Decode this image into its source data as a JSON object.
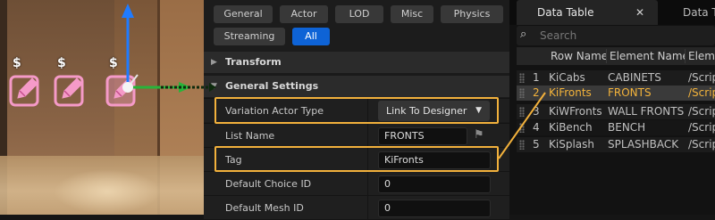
{
  "details": {
    "filter_tabs": [
      {
        "label": "General"
      },
      {
        "label": "Actor"
      },
      {
        "label": "LOD"
      },
      {
        "label": "Misc"
      },
      {
        "label": "Physics"
      },
      {
        "label": "Streaming"
      },
      {
        "label": "All",
        "active": true
      }
    ],
    "sections": {
      "transform": "Transform",
      "general_settings": "General Settings"
    },
    "properties": [
      {
        "label": "Variation Actor Type",
        "value": "Link To Designer",
        "type": "combo"
      },
      {
        "label": "List Name",
        "value": "FRONTS",
        "type": "text"
      },
      {
        "label": "Tag",
        "value": "KiFronts",
        "type": "text"
      },
      {
        "label": "Default Choice ID",
        "value": "0",
        "type": "text"
      },
      {
        "label": "Default Mesh ID",
        "value": "0",
        "type": "text"
      }
    ]
  },
  "data_table": {
    "tabs": [
      {
        "label": "Data Table",
        "active": true
      },
      {
        "label": "Data T"
      }
    ],
    "search_placeholder": "Search",
    "columns": [
      "Row Name",
      "Element Name",
      "Eleme"
    ],
    "rows": [
      {
        "index": "1",
        "row_name": "KiCabs",
        "element_name": "CABINETS",
        "element": "/Scrip"
      },
      {
        "index": "2",
        "row_name": "KiFronts",
        "element_name": "FRONTS",
        "element": "/Scrip",
        "selected": true
      },
      {
        "index": "3",
        "row_name": "KiWFronts",
        "element_name": "WALL FRONTS",
        "element": "/Scrip"
      },
      {
        "index": "4",
        "row_name": "KiBench",
        "element_name": "BENCH",
        "element": "/Scrip"
      },
      {
        "index": "5",
        "row_name": "KiSplash",
        "element_name": "SPLASHBACK",
        "element": "/Scrip"
      }
    ]
  },
  "viewport": {
    "price_markers": [
      "$",
      "$",
      "$"
    ]
  },
  "colors": {
    "highlight": "#f2b13c",
    "active_filter": "#0e63d6",
    "selected_row_text": "#f3b33b"
  }
}
